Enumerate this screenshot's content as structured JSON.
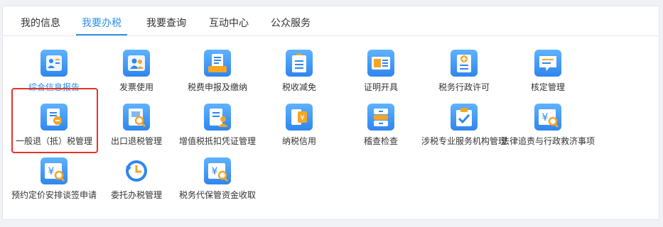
{
  "tabs": [
    {
      "label": "我的信息",
      "active": false
    },
    {
      "label": "我要办税",
      "active": true
    },
    {
      "label": "我要查询",
      "active": false
    },
    {
      "label": "互动中心",
      "active": false
    },
    {
      "label": "公众服务",
      "active": false
    }
  ],
  "accent_color": "#2f8ff0",
  "highlight_color": "#e8322c",
  "items": [
    {
      "label": "综合信息报告",
      "icon": "user-card-icon",
      "selected_text": true
    },
    {
      "label": "发票使用",
      "icon": "users-icon"
    },
    {
      "label": "税费申报及缴纳",
      "icon": "tray-document-icon"
    },
    {
      "label": "税收减免",
      "icon": "document-list-icon"
    },
    {
      "label": "证明开具",
      "icon": "ticket-certificate-icon"
    },
    {
      "label": "税务行政许可",
      "icon": "plus-document-icon"
    },
    {
      "label": "核定管理",
      "icon": "speech-bubble-icon"
    },
    {
      "label": "一般退（抵）税管理",
      "icon": "document-stamp-icon",
      "boxed": true
    },
    {
      "label": "出口退税管理",
      "icon": "search-document-icon"
    },
    {
      "label": "增值税抵扣凭证管理",
      "icon": "document-person-icon"
    },
    {
      "label": "纳税信用",
      "icon": "credit-yuan-icon"
    },
    {
      "label": "稽查检查",
      "icon": "cabinet-icon"
    },
    {
      "label": "涉税专业服务机构管理",
      "icon": "check-clipboard-icon"
    },
    {
      "label": "法律追责与行政救济事项",
      "icon": "yuan-search-icon"
    },
    {
      "label": "预约定价安排谈签申请",
      "icon": "yuan-search-icon"
    },
    {
      "label": "委托办税管理",
      "icon": "clock-history-icon"
    },
    {
      "label": "税务代保管资金收取",
      "icon": "yuan-search-icon"
    }
  ]
}
